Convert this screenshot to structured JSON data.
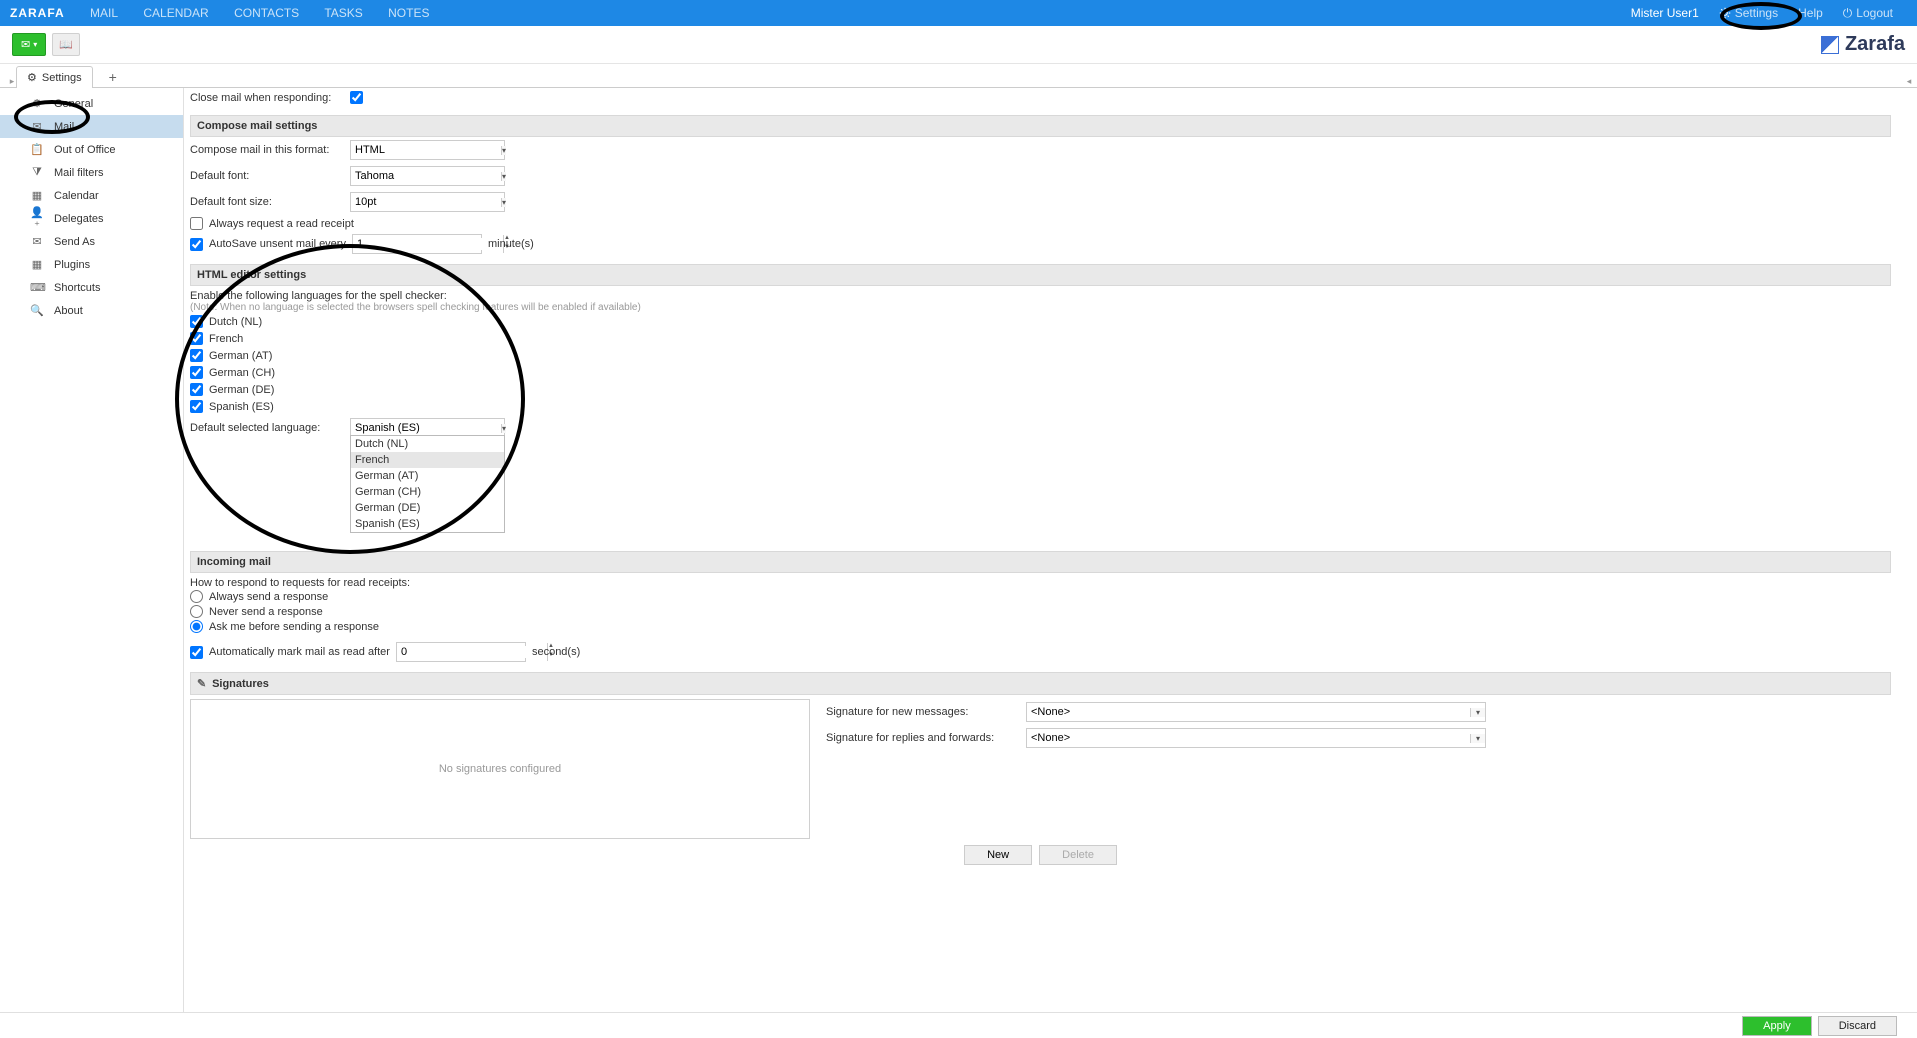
{
  "topnav": {
    "brand": "ZARAFA",
    "items": [
      "MAIL",
      "CALENDAR",
      "CONTACTS",
      "TASKS",
      "NOTES"
    ],
    "user": "Mister User1",
    "settings": "Settings",
    "help": "Help",
    "logout": "Logout"
  },
  "logo_text": "Zarafa",
  "tab": {
    "label": "Settings"
  },
  "sidebar": {
    "items": [
      {
        "label": "General",
        "icon": "⚙"
      },
      {
        "label": "Mail",
        "icon": "✉"
      },
      {
        "label": "Out of Office",
        "icon": "📋"
      },
      {
        "label": "Mail filters",
        "icon": "⧩"
      },
      {
        "label": "Calendar",
        "icon": "▦"
      },
      {
        "label": "Delegates",
        "icon": "👤⁺"
      },
      {
        "label": "Send As",
        "icon": "✉"
      },
      {
        "label": "Plugins",
        "icon": "▦"
      },
      {
        "label": "Shortcuts",
        "icon": "⌨"
      },
      {
        "label": "About",
        "icon": "🔍"
      }
    ]
  },
  "close_mail_label": "Close mail when responding:",
  "sections": {
    "compose": "Compose mail settings",
    "html": "HTML editor settings",
    "incoming": "Incoming mail",
    "signatures": "Signatures"
  },
  "compose": {
    "format_label": "Compose mail in this format:",
    "format_value": "HTML",
    "font_label": "Default font:",
    "font_value": "Tahoma",
    "fontsize_label": "Default font size:",
    "fontsize_value": "10pt",
    "read_receipt": "Always request a read receipt",
    "autosave_prefix": "AutoSave unsent mail every",
    "autosave_value": "1",
    "autosave_suffix": "minute(s)"
  },
  "htmled": {
    "enable_label": "Enable the following languages for the spell checker:",
    "note": "(Note: When no language is selected the browsers spell checking features will be enabled if available)",
    "langs": [
      "Dutch (NL)",
      "French",
      "German (AT)",
      "German (CH)",
      "German (DE)",
      "Spanish (ES)"
    ],
    "default_lang_label": "Default selected language:",
    "default_lang_value": "Spanish (ES)",
    "dropdown": [
      "Dutch (NL)",
      "French",
      "German (AT)",
      "German (CH)",
      "German (DE)",
      "Spanish (ES)"
    ]
  },
  "incoming": {
    "howto": "How to respond to requests for read receipts:",
    "opts": [
      "Always send a response",
      "Never send a response",
      "Ask me before sending a response"
    ],
    "auto_mark_prefix": "Automatically mark mail as read after",
    "auto_mark_value": "0",
    "auto_mark_suffix": "second(s)"
  },
  "signatures": {
    "empty": "No signatures configured",
    "new_msg_label": "Signature for new messages:",
    "reply_label": "Signature for replies and forwards:",
    "none": "<None>",
    "new_btn": "New",
    "delete_btn": "Delete"
  },
  "footer": {
    "apply": "Apply",
    "discard": "Discard"
  }
}
